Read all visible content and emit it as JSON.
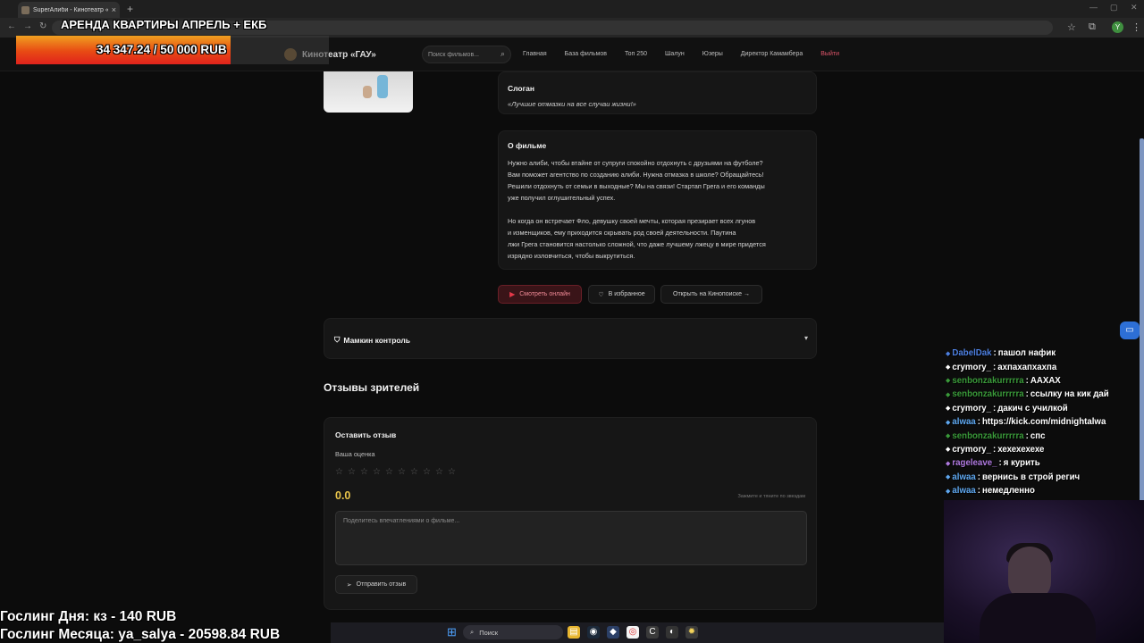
{
  "browser": {
    "tab_title": "SuperАлиби - Кинотеатр «ГАУ»",
    "tab_close": "×",
    "new_tab": "+",
    "profile_initial": "Y"
  },
  "site": {
    "brand": "Кинотеатр «ГАУ»",
    "search_placeholder": "Поиск фильмов...",
    "nav": [
      "Главная",
      "База фильмов",
      "Топ 250",
      "Шалун",
      "Юзеры",
      "Директор Камамбера",
      "Выйти"
    ]
  },
  "movie": {
    "slogan_title": "Слоган",
    "slogan": "«Лучшие отмазки на все случаи жизни!»",
    "about_title": "О фильме",
    "about_p1": [
      "Нужно алиби, чтобы втайне от супруги спокойно отдохнуть с друзьями на футболе?",
      "Вам поможет агентство по созданию алиби. Нужна отмазка в школе? Обращайтесь!",
      "Решили отдохнуть от семьи в выходные? Мы на связи! Стартап Грега и его команды",
      "уже получил оглушительный успех."
    ],
    "about_p2": [
      "Но когда он встречает Фло, девушку своей мечты, которая презирает всех лгунов",
      "и изменщиков, ему приходится скрывать род своей деятельности. Паутина",
      "лжи Грега становится настолько сложной, что даже лучшему лжецу в мире придется",
      "изрядно изловчиться, чтобы выкрутиться."
    ],
    "watch_btn": "Смотреть онлайн",
    "fav_btn": "В избранное",
    "kp_btn": "Открыть на Кинопоиске →",
    "mom_control": "Мамкин контроль"
  },
  "reviews": {
    "title": "Отзывы зрителей",
    "leave_title": "Оставить отзыв",
    "rating_label": "Ваша оценка",
    "stars_total": 10,
    "star_glyph": "☆",
    "score": "0.0",
    "hint": "Зажмите и тяните по звездам",
    "textarea_placeholder": "Поделитесь впечатлениями о фильме...",
    "send_btn": "Отправить отзыв"
  },
  "overlay": {
    "title": "АРЕНДА КВАРТИРЫ АПРЕЛЬ + ЕКБ",
    "goal_text": "34 347.24 / 50 000 RUB",
    "goal_fraction": 0.687,
    "gosling_day": "Гослинг Дня: кз - 140 RUB",
    "gosling_month": "Гослинг Месяца: ya_salya - 20598.84 RUB"
  },
  "chat": [
    {
      "user": "DabelDak",
      "text": "пашол нафик",
      "color": "#4d7fe0"
    },
    {
      "user": "crymory_",
      "text": "ахпахапхахпа",
      "color": "#ffffff"
    },
    {
      "user": "senbonzakurrrrra",
      "text": "ААХАХ",
      "color": "#3a9a3a"
    },
    {
      "user": "senbonzakurrrrra",
      "text": "ссылку на кик дай",
      "color": "#3a9a3a"
    },
    {
      "user": "crymory_",
      "text": "дакич с училкой",
      "color": "#ffffff"
    },
    {
      "user": "alwaa",
      "text": "https://kick.com/midnightalwa",
      "color": "#5fa8f0"
    },
    {
      "user": "senbonzakurrrrra",
      "text": "спс",
      "color": "#3a9a3a"
    },
    {
      "user": "crymory_",
      "text": "хехехехехе",
      "color": "#ffffff"
    },
    {
      "user": "rageleave_",
      "text": "я курить",
      "color": "#b07ae0"
    },
    {
      "user": "alwaa",
      "text": "вернись в строй регич",
      "color": "#5fa8f0"
    },
    {
      "user": "alwaa",
      "text": "немедленно",
      "color": "#5fa8f0"
    }
  ],
  "taskbar": {
    "search": "Поиск"
  }
}
